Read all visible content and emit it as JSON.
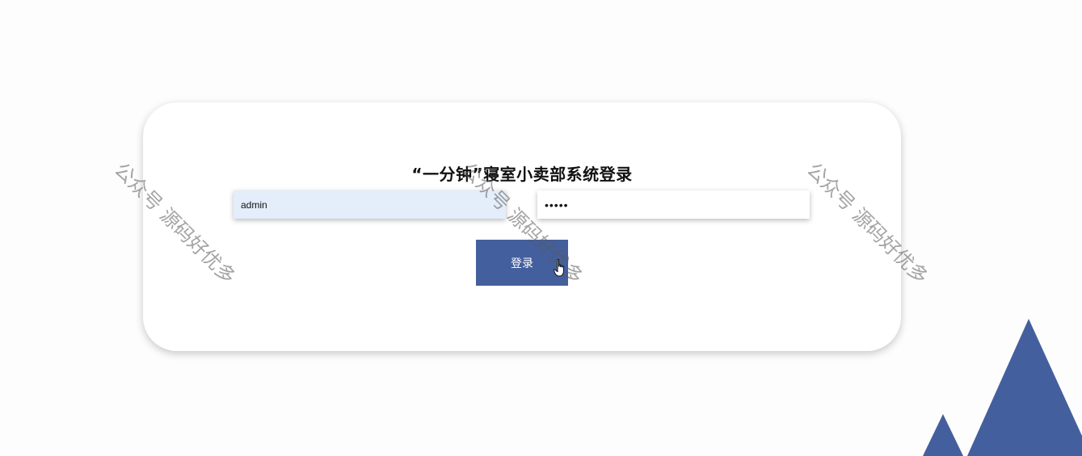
{
  "login": {
    "title": "“一分钟”寝室小卖部系统登录",
    "username_value": "admin",
    "password_value": "•••••",
    "button_label": "登录"
  },
  "watermark": {
    "text": "公众号 源码好优多"
  },
  "icons": {
    "cursor": "hand-pointer-icon",
    "decoration": "mountains-icon"
  },
  "colors": {
    "brand": "#445f9d",
    "username_bg": "#e4edfa",
    "card_bg": "#ffffff"
  }
}
